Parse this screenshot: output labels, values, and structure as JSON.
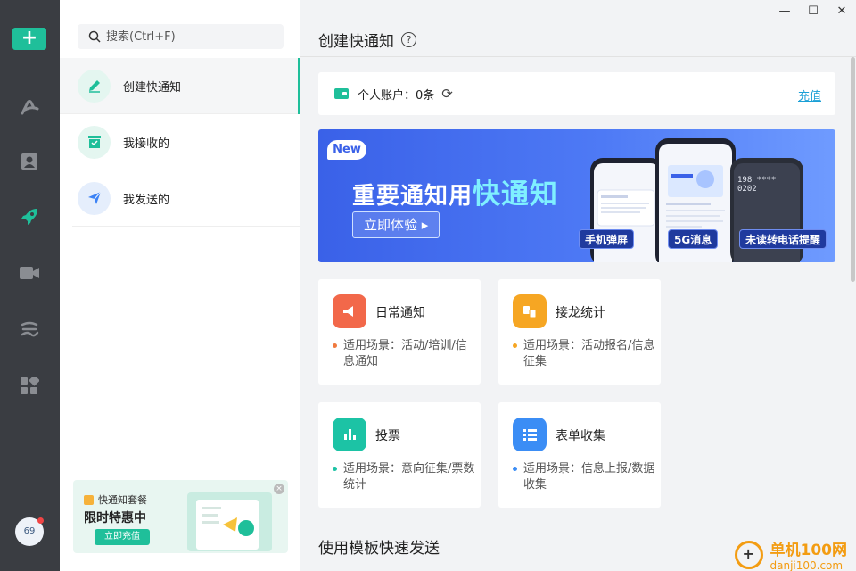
{
  "rail": {
    "add_label": "+",
    "items": [
      {
        "icon": "brand-a-icon"
      },
      {
        "icon": "contacts-icon"
      },
      {
        "icon": "rocket-icon"
      },
      {
        "icon": "video-icon"
      },
      {
        "icon": "cloud-icon"
      },
      {
        "icon": "apps-icon"
      }
    ],
    "avatar_text": "69"
  },
  "sidebar": {
    "search_placeholder": "搜索(Ctrl+F)",
    "items": [
      {
        "label": "创建快通知",
        "icon": "pen-icon",
        "color": "#1fbf9a"
      },
      {
        "label": "我接收的",
        "icon": "inbox-icon",
        "color": "#1fbf9a"
      },
      {
        "label": "我发送的",
        "icon": "send-icon",
        "color": "#3b82f6"
      }
    ],
    "promo": {
      "tag": "快通知套餐",
      "headline": "限时特惠中",
      "button": "立即充值"
    }
  },
  "window": {
    "minimize": "—",
    "maximize": "☐",
    "close": "✕"
  },
  "main": {
    "title": "创建快通知",
    "help": "?",
    "account": {
      "label": "个人账户：0条",
      "recharge": "充值"
    },
    "banner": {
      "badge": "New",
      "headline_prefix": "重要通知用",
      "headline_highlight": "快通知",
      "cta": "立即体验 ▸",
      "chips": [
        "手机弹屏",
        "5G消息",
        "未读转电话提醒"
      ],
      "phone_number": "198 **** 0202"
    },
    "cards": [
      {
        "title": "日常通知",
        "desc": "适用场景：活动/培训/信息通知",
        "icon": "megaphone-icon",
        "color": "#f2684a",
        "bullet": "#f07a3f"
      },
      {
        "title": "接龙统计",
        "desc": "适用场景：活动报名/信息征集",
        "icon": "relay-icon",
        "color": "#f6a623",
        "bullet": "#f6a623"
      },
      {
        "title": "投票",
        "desc": "适用场景：意向征集/票数统计",
        "icon": "bar-chart-icon",
        "color": "#1cc3a5",
        "bullet": "#1cc3a5"
      },
      {
        "title": "表单收集",
        "desc": "适用场景：信息上报/数据收集",
        "icon": "list-icon",
        "color": "#3b8df5",
        "bullet": "#3b8df5"
      }
    ],
    "section_title": "使用模板快速发送"
  },
  "watermark": {
    "name": "单机100网",
    "url": "danji100.com"
  }
}
